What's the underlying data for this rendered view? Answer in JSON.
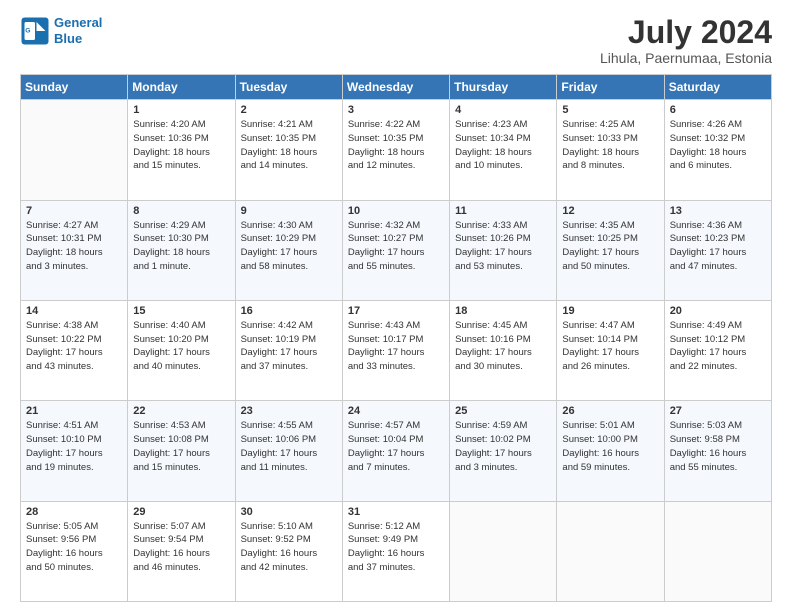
{
  "header": {
    "logo_line1": "General",
    "logo_line2": "Blue",
    "title": "July 2024",
    "subtitle": "Lihula, Paernumaa, Estonia"
  },
  "weekdays": [
    "Sunday",
    "Monday",
    "Tuesday",
    "Wednesday",
    "Thursday",
    "Friday",
    "Saturday"
  ],
  "weeks": [
    [
      {
        "day": "",
        "info": ""
      },
      {
        "day": "1",
        "info": "Sunrise: 4:20 AM\nSunset: 10:36 PM\nDaylight: 18 hours\nand 15 minutes."
      },
      {
        "day": "2",
        "info": "Sunrise: 4:21 AM\nSunset: 10:35 PM\nDaylight: 18 hours\nand 14 minutes."
      },
      {
        "day": "3",
        "info": "Sunrise: 4:22 AM\nSunset: 10:35 PM\nDaylight: 18 hours\nand 12 minutes."
      },
      {
        "day": "4",
        "info": "Sunrise: 4:23 AM\nSunset: 10:34 PM\nDaylight: 18 hours\nand 10 minutes."
      },
      {
        "day": "5",
        "info": "Sunrise: 4:25 AM\nSunset: 10:33 PM\nDaylight: 18 hours\nand 8 minutes."
      },
      {
        "day": "6",
        "info": "Sunrise: 4:26 AM\nSunset: 10:32 PM\nDaylight: 18 hours\nand 6 minutes."
      }
    ],
    [
      {
        "day": "7",
        "info": "Sunrise: 4:27 AM\nSunset: 10:31 PM\nDaylight: 18 hours\nand 3 minutes."
      },
      {
        "day": "8",
        "info": "Sunrise: 4:29 AM\nSunset: 10:30 PM\nDaylight: 18 hours\nand 1 minute."
      },
      {
        "day": "9",
        "info": "Sunrise: 4:30 AM\nSunset: 10:29 PM\nDaylight: 17 hours\nand 58 minutes."
      },
      {
        "day": "10",
        "info": "Sunrise: 4:32 AM\nSunset: 10:27 PM\nDaylight: 17 hours\nand 55 minutes."
      },
      {
        "day": "11",
        "info": "Sunrise: 4:33 AM\nSunset: 10:26 PM\nDaylight: 17 hours\nand 53 minutes."
      },
      {
        "day": "12",
        "info": "Sunrise: 4:35 AM\nSunset: 10:25 PM\nDaylight: 17 hours\nand 50 minutes."
      },
      {
        "day": "13",
        "info": "Sunrise: 4:36 AM\nSunset: 10:23 PM\nDaylight: 17 hours\nand 47 minutes."
      }
    ],
    [
      {
        "day": "14",
        "info": "Sunrise: 4:38 AM\nSunset: 10:22 PM\nDaylight: 17 hours\nand 43 minutes."
      },
      {
        "day": "15",
        "info": "Sunrise: 4:40 AM\nSunset: 10:20 PM\nDaylight: 17 hours\nand 40 minutes."
      },
      {
        "day": "16",
        "info": "Sunrise: 4:42 AM\nSunset: 10:19 PM\nDaylight: 17 hours\nand 37 minutes."
      },
      {
        "day": "17",
        "info": "Sunrise: 4:43 AM\nSunset: 10:17 PM\nDaylight: 17 hours\nand 33 minutes."
      },
      {
        "day": "18",
        "info": "Sunrise: 4:45 AM\nSunset: 10:16 PM\nDaylight: 17 hours\nand 30 minutes."
      },
      {
        "day": "19",
        "info": "Sunrise: 4:47 AM\nSunset: 10:14 PM\nDaylight: 17 hours\nand 26 minutes."
      },
      {
        "day": "20",
        "info": "Sunrise: 4:49 AM\nSunset: 10:12 PM\nDaylight: 17 hours\nand 22 minutes."
      }
    ],
    [
      {
        "day": "21",
        "info": "Sunrise: 4:51 AM\nSunset: 10:10 PM\nDaylight: 17 hours\nand 19 minutes."
      },
      {
        "day": "22",
        "info": "Sunrise: 4:53 AM\nSunset: 10:08 PM\nDaylight: 17 hours\nand 15 minutes."
      },
      {
        "day": "23",
        "info": "Sunrise: 4:55 AM\nSunset: 10:06 PM\nDaylight: 17 hours\nand 11 minutes."
      },
      {
        "day": "24",
        "info": "Sunrise: 4:57 AM\nSunset: 10:04 PM\nDaylight: 17 hours\nand 7 minutes."
      },
      {
        "day": "25",
        "info": "Sunrise: 4:59 AM\nSunset: 10:02 PM\nDaylight: 17 hours\nand 3 minutes."
      },
      {
        "day": "26",
        "info": "Sunrise: 5:01 AM\nSunset: 10:00 PM\nDaylight: 16 hours\nand 59 minutes."
      },
      {
        "day": "27",
        "info": "Sunrise: 5:03 AM\nSunset: 9:58 PM\nDaylight: 16 hours\nand 55 minutes."
      }
    ],
    [
      {
        "day": "28",
        "info": "Sunrise: 5:05 AM\nSunset: 9:56 PM\nDaylight: 16 hours\nand 50 minutes."
      },
      {
        "day": "29",
        "info": "Sunrise: 5:07 AM\nSunset: 9:54 PM\nDaylight: 16 hours\nand 46 minutes."
      },
      {
        "day": "30",
        "info": "Sunrise: 5:10 AM\nSunset: 9:52 PM\nDaylight: 16 hours\nand 42 minutes."
      },
      {
        "day": "31",
        "info": "Sunrise: 5:12 AM\nSunset: 9:49 PM\nDaylight: 16 hours\nand 37 minutes."
      },
      {
        "day": "",
        "info": ""
      },
      {
        "day": "",
        "info": ""
      },
      {
        "day": "",
        "info": ""
      }
    ]
  ]
}
